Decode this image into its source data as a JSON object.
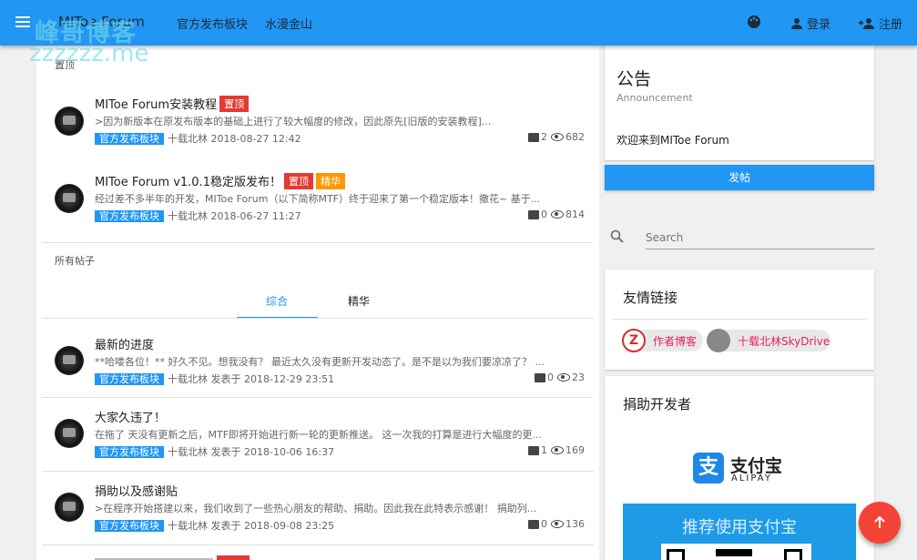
{
  "appbar": {
    "title": "MIToe Forum",
    "nav": [
      "官方发布板块",
      "水漫金山"
    ],
    "login": "登录",
    "register": "注册"
  },
  "watermark": {
    "line1": "峰哥博客",
    "line2": "zzzzzz.me"
  },
  "sections": {
    "pinned": "置顶",
    "all": "所有帖子"
  },
  "pinned_posts": [
    {
      "title": "MIToe Forum安装教程",
      "tags": [
        "置顶"
      ],
      "excerpt": ">因为新版本在原发布版本的基础上进行了较大幅度的修改，因此原先[旧版的安装教程]...",
      "board": "官方发布板块",
      "meta": "十载北林 2018-08-27 12:42",
      "comments": "2",
      "views": "682"
    },
    {
      "title": "MIToe Forum v1.0.1稳定版发布！",
      "tags": [
        "置顶",
        "精华"
      ],
      "excerpt": "经过差不多半年的开发，MIToe Forum（以下简称MTF）终于迎来了第一个稳定版本！撒花~ 基于...",
      "board": "官方发布板块",
      "meta": "十载北林 2018-06-27 11:27",
      "comments": "0",
      "views": "814"
    }
  ],
  "tabs": [
    "综合",
    "精华"
  ],
  "posts": [
    {
      "title": "最新的进度",
      "excerpt": "**哈喽各位！** 好久不见。想我没有？ 最近太久没有更新开发动态了。是不是以为我们要凉凉了？ ...",
      "board": "官方发布板块",
      "meta": "十载北林 发表于 2018-12-29 23:51",
      "comments": "0",
      "views": "23"
    },
    {
      "title": "大家久违了！",
      "excerpt": "在拖了 天没有更新之后，MTF即将开始进行新一轮的更新推送。 这一次我的打算是进行大幅度的更...",
      "board": "官方发布板块",
      "meta": "十载北林 发表于 2018-10-06 16:37",
      "comments": "1",
      "views": "169"
    },
    {
      "title": "捐助以及感谢贴",
      "excerpt": ">在程序开始搭建以来，我们收到了一些热心朋友的帮助、捐助。因此我在此特表示感谢！ 捐助列...",
      "board": "官方发布板块",
      "meta": "十载北林 发表于 2018-09-08 23:25",
      "comments": "0",
      "views": "136"
    }
  ],
  "announcement": {
    "title": "公告",
    "subtitle": "Announcement",
    "text": "欢迎来到MIToe Forum"
  },
  "post_button": "发帖",
  "search": {
    "placeholder": "Search"
  },
  "links": {
    "title": "友情链接",
    "items": [
      "作者博客",
      "十载北林SkyDrive"
    ]
  },
  "donate": {
    "title": "捐助开发者",
    "alipay_cn": "支付宝",
    "alipay_en": "ALIPAY",
    "banner": "推荐使用支付宝"
  },
  "colors": {
    "primary": "#2196f3",
    "accent": "#f44336",
    "tag_red": "#e53935",
    "tag_orange": "#ff9800"
  }
}
